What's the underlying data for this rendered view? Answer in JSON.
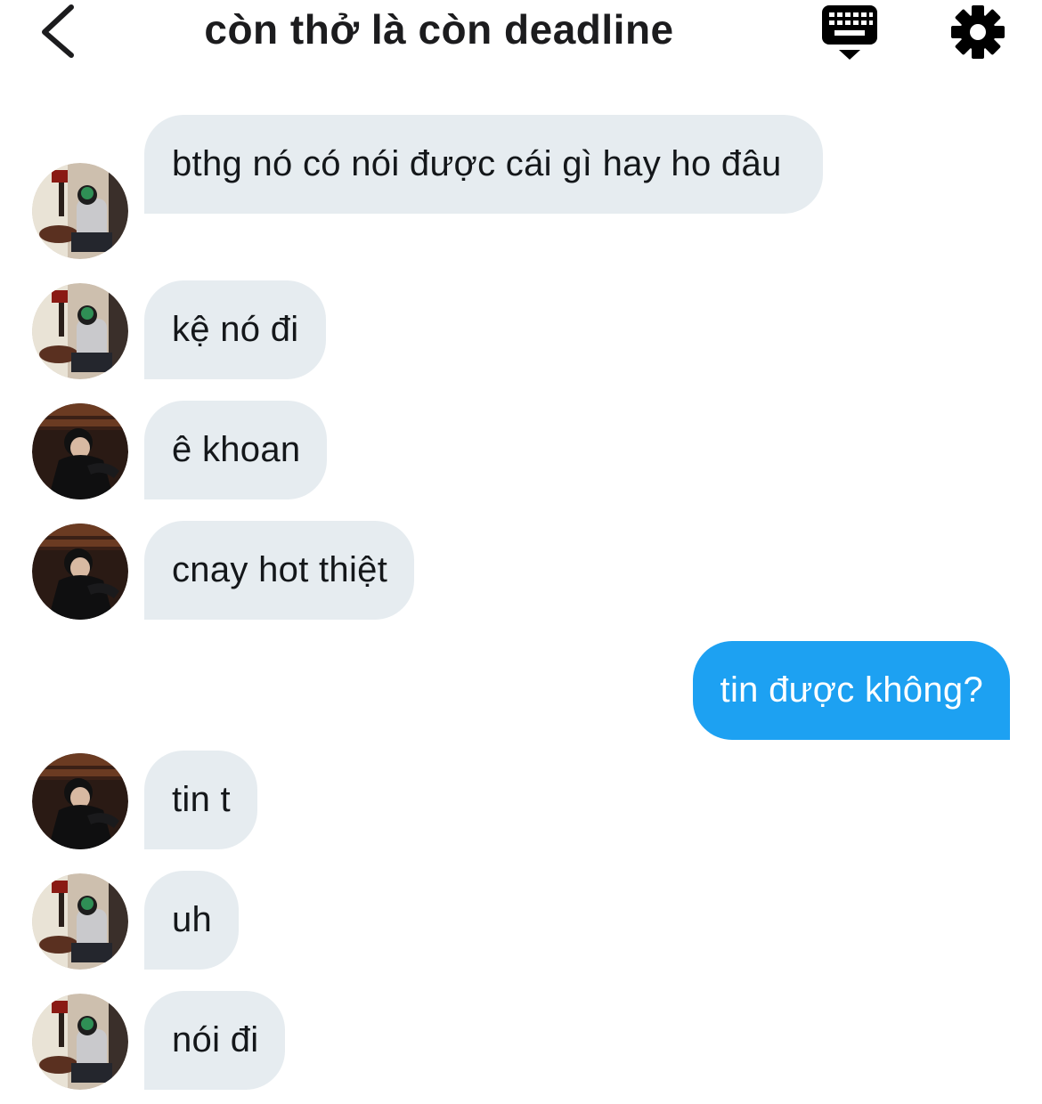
{
  "header": {
    "title": "còn thở là còn deadline",
    "back_icon": "chevron-left-icon",
    "keyboard_icon": "keyboard-icon",
    "settings_icon": "gear-icon"
  },
  "colors": {
    "incoming_bubble": "#e6ecf0",
    "outgoing_bubble": "#1da1f2",
    "text": "#14171a"
  },
  "messages": [
    {
      "direction": "in",
      "sender_avatar": "avatar-a",
      "text": "bthg nó có nói được cái gì hay ho đâu"
    },
    {
      "direction": "in",
      "sender_avatar": "avatar-a",
      "text": "kệ nó đi"
    },
    {
      "direction": "in",
      "sender_avatar": "avatar-b",
      "text": "ê khoan"
    },
    {
      "direction": "in",
      "sender_avatar": "avatar-b",
      "text": "cnay hot thiệt"
    },
    {
      "direction": "out",
      "text": "tin được không?"
    },
    {
      "direction": "in",
      "sender_avatar": "avatar-b",
      "text": "tin t"
    },
    {
      "direction": "in",
      "sender_avatar": "avatar-a",
      "text": "uh"
    },
    {
      "direction": "in",
      "sender_avatar": "avatar-a",
      "text": "nói đi"
    }
  ]
}
